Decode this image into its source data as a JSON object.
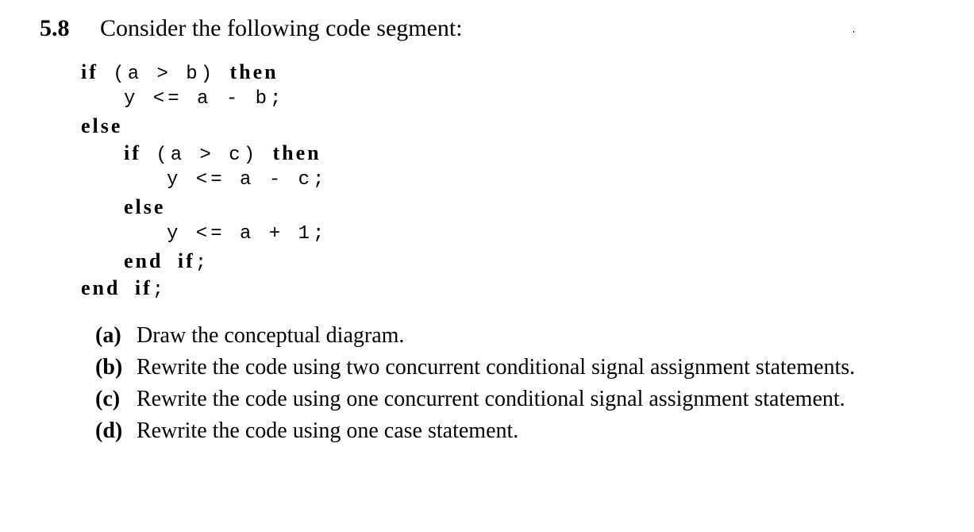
{
  "problem": {
    "number": "5.8",
    "intro": "Consider the following code segment:"
  },
  "code": [
    {
      "indent": 0,
      "tokens": [
        {
          "t": "if",
          "kw": true
        },
        {
          "t": " (a > b) "
        },
        {
          "t": "then",
          "kw": true
        }
      ]
    },
    {
      "indent": 1,
      "tokens": [
        {
          "t": "y <= a - b;"
        }
      ]
    },
    {
      "indent": 0,
      "tokens": [
        {
          "t": "else",
          "kw": true
        }
      ]
    },
    {
      "indent": 1,
      "tokens": [
        {
          "t": "if",
          "kw": true
        },
        {
          "t": " (a > c) "
        },
        {
          "t": "then",
          "kw": true
        }
      ]
    },
    {
      "indent": 2,
      "tokens": [
        {
          "t": "y <= a - c;"
        }
      ]
    },
    {
      "indent": 1,
      "tokens": [
        {
          "t": "else",
          "kw": true
        }
      ]
    },
    {
      "indent": 2,
      "tokens": [
        {
          "t": "y <= a + 1;"
        }
      ]
    },
    {
      "indent": 1,
      "tokens": [
        {
          "t": "end",
          "kw": true
        },
        {
          "t": " "
        },
        {
          "t": "if",
          "kw": true
        },
        {
          "t": ";"
        }
      ]
    },
    {
      "indent": 0,
      "tokens": [
        {
          "t": "end",
          "kw": true
        },
        {
          "t": " "
        },
        {
          "t": "if",
          "kw": true
        },
        {
          "t": ";"
        }
      ]
    }
  ],
  "parts": [
    {
      "label": "(a)",
      "text": "Draw the conceptual diagram."
    },
    {
      "label": "(b)",
      "text": "Rewrite the code using two concurrent conditional signal assignment statements."
    },
    {
      "label": "(c)",
      "text": "Rewrite the code using one concurrent conditional signal assignment statement."
    },
    {
      "label": "(d)",
      "text": "Rewrite the code using one case statement."
    }
  ]
}
